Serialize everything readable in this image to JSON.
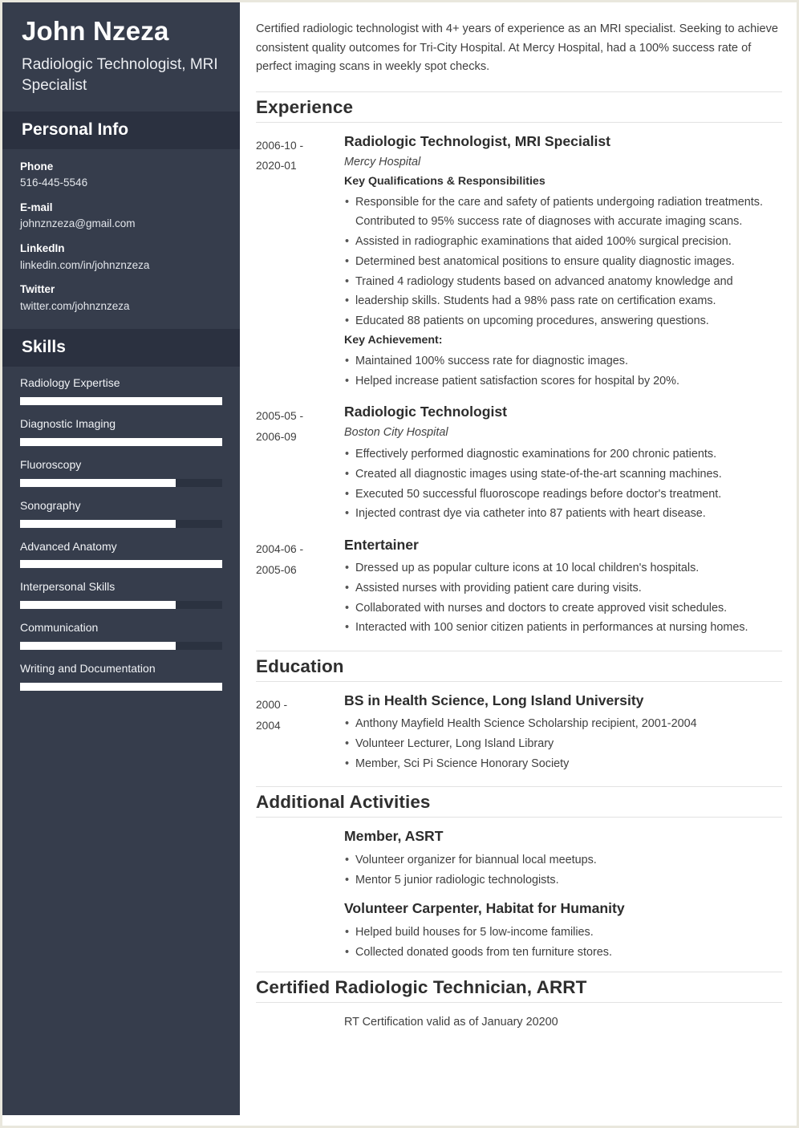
{
  "sidebar": {
    "full_name": "John Nzeza",
    "job_title": "Radiologic Technologist, MRI Specialist",
    "personal_info": {
      "heading": "Personal Info",
      "items": [
        {
          "label": "Phone",
          "value": "516-445-5546"
        },
        {
          "label": "E-mail",
          "value": "johnznzeza@gmail.com"
        },
        {
          "label": "LinkedIn",
          "value": "linkedin.com/in/johnznzeza"
        },
        {
          "label": "Twitter",
          "value": "twitter.com/johnznzeza"
        }
      ]
    },
    "skills": {
      "heading": "Skills",
      "items": [
        {
          "name": "Radiology Expertise",
          "level": 100
        },
        {
          "name": "Diagnostic Imaging",
          "level": 100
        },
        {
          "name": "Fluoroscopy",
          "level": 77
        },
        {
          "name": "Sonography",
          "level": 77
        },
        {
          "name": "Advanced Anatomy",
          "level": 100
        },
        {
          "name": "Interpersonal Skills",
          "level": 77
        },
        {
          "name": "Communication",
          "level": 77
        },
        {
          "name": "Writing and Documentation",
          "level": 100
        }
      ]
    }
  },
  "main": {
    "summary": "Certified radiologic technologist with 4+ years of experience as an MRI specialist. Seeking to achieve consistent quality outcomes for Tri-City Hospital. At Mercy Hospital, had a 100% success rate of perfect imaging scans in weekly spot checks.",
    "experience": {
      "heading": "Experience",
      "entries": [
        {
          "date_from": "2006-10 -",
          "date_to": "2020-01",
          "title": "Radiologic Technologist, MRI Specialist",
          "org": "Mercy Hospital",
          "sub_heading": "Key Qualifications & Responsibilities",
          "bullets": [
            "Responsible for the care and safety of patients undergoing radiation treatments. Contributed to 95% success rate of diagnoses with accurate imaging scans.",
            "Assisted in radiographic examinations that aided 100% surgical precision.",
            "Determined best anatomical positions to ensure quality diagnostic images.",
            "Trained 4 radiology students based on advanced anatomy knowledge and",
            "leadership skills. Students had a 98% pass rate on certification exams.",
            "Educated 88 patients on upcoming procedures, answering questions."
          ],
          "sub_heading_2": "Key Achievement:",
          "bullets_2": [
            "Maintained 100% success rate for diagnostic images.",
            "Helped increase patient satisfaction scores for hospital by 20%."
          ]
        },
        {
          "date_from": "2005-05 -",
          "date_to": "2006-09",
          "title": "Radiologic Technologist",
          "org": "Boston City Hospital",
          "bullets": [
            "Effectively performed diagnostic examinations for 200 chronic patients.",
            "Created all diagnostic images using state-of-the-art scanning machines.",
            "Executed 50 successful fluoroscope readings before doctor's treatment.",
            "Injected contrast dye via catheter into 87 patients with heart disease."
          ]
        },
        {
          "date_from": "2004-06 -",
          "date_to": "2005-06",
          "title": "Entertainer",
          "org": "",
          "bullets": [
            "Dressed up as popular culture icons at 10 local children's hospitals.",
            "Assisted nurses with providing patient care during visits.",
            "Collaborated with nurses and doctors to create approved visit schedules.",
            "Interacted with 100 senior citizen patients in performances at nursing homes."
          ]
        }
      ]
    },
    "education": {
      "heading": "Education",
      "entries": [
        {
          "date_from": "2000 -",
          "date_to": "2004",
          "title": "BS in Health Science, Long Island University",
          "bullets": [
            "Anthony Mayfield Health Science Scholarship recipient, 2001-2004",
            "Volunteer Lecturer, Long Island Library",
            "Member, Sci Pi Science Honorary Society"
          ]
        }
      ]
    },
    "activities": {
      "heading": "Additional Activities",
      "blocks": [
        {
          "title": "Member, ASRT",
          "bullets": [
            "Volunteer organizer for biannual local meetups.",
            "Mentor 5 junior radiologic technologists."
          ]
        },
        {
          "title": "Volunteer Carpenter, Habitat for Humanity",
          "bullets": [
            "Helped build houses for 5 low-income families.",
            "Collected donated goods from ten furniture stores."
          ]
        }
      ]
    },
    "certification": {
      "heading": "Certified Radiologic Technician, ARRT",
      "text": "RT Certification valid as of January 20200"
    }
  },
  "colors": {
    "sidebar_bg": "#363d4c",
    "sidebar_head_bg": "#2b3140",
    "skill_track": "#2b3240",
    "skill_fill": "#ffffff",
    "page_border": "#e9e7dd",
    "rule": "#e2e2e2",
    "text": "#3f3f3f"
  }
}
